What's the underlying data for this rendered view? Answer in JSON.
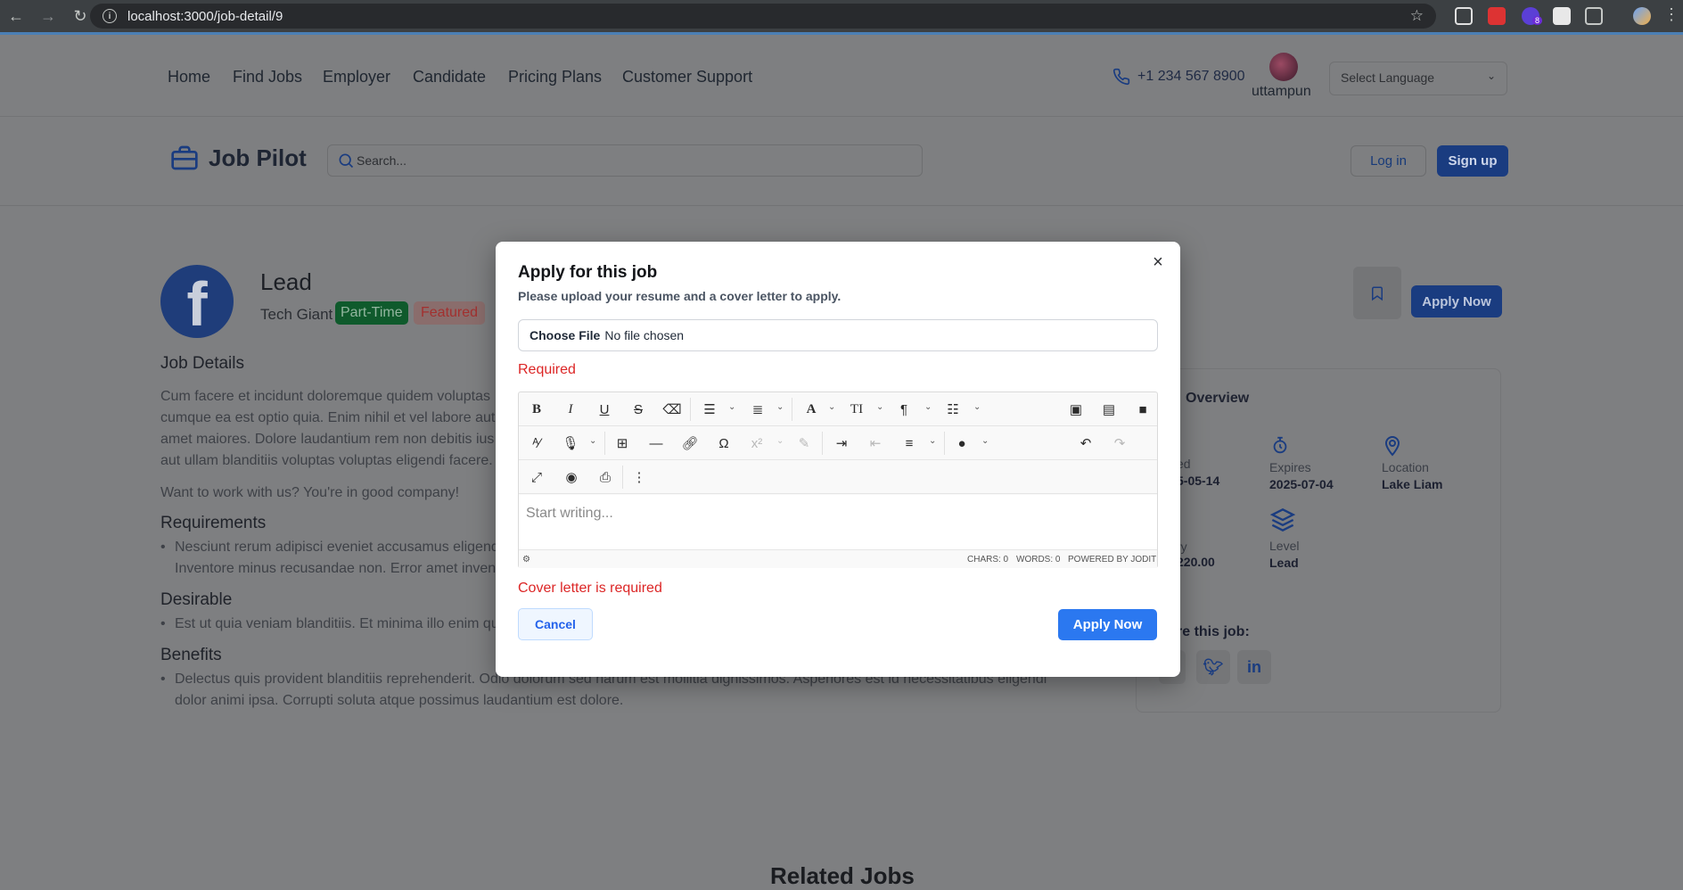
{
  "browser": {
    "url": "localhost:3000/job-detail/9",
    "ext_badge": "8"
  },
  "nav": {
    "links": [
      "Home",
      "Find Jobs",
      "Employer",
      "Candidate",
      "Pricing Plans",
      "Customer Support"
    ],
    "phone": "+1 234 567 8900",
    "username": "uttampun",
    "language_placeholder": "Select Language"
  },
  "header": {
    "logo_text": "Job Pilot",
    "search_placeholder": "Search...",
    "login": "Log in",
    "signup": "Sign up"
  },
  "job": {
    "logo_letter": "f",
    "title": "Lead",
    "company": "Tech Giant",
    "tags": [
      "Part-Time",
      "Featured"
    ],
    "apply_now": "Apply Now",
    "details_heading": "Job Details",
    "details_lines": [
      "Cum facere et incidunt doloremque quidem voluptas",
      "cumque ea est optio quia. Enim nihil et vel labore aut",
      "amet maiores. Dolore laudantium rem non debitis ius",
      "aut ullam blanditiis voluptas voluptas eligendi facere."
    ],
    "tagline": "Want to work with us? You're in good company!",
    "requirements_heading": "Requirements",
    "requirements_lines": [
      "Nesciunt rerum adipisci eveniet accusamus eligend",
      "Inventore minus recusandae non. Error amet invent"
    ],
    "desirable_heading": "Desirable",
    "desirable_line": "Est ut quia veniam blanditiis. Et minima illo enim qu",
    "benefits_heading": "Benefits",
    "benefits_lines": [
      "Delectus quis provident blanditiis reprehenderit. Odio dolorum sed harum est mollitia dignissimos. Asperiores est id necessitatibus eligendi",
      "dolor animi ipsa. Corrupti soluta atque possimus laudantium est dolore."
    ]
  },
  "overview": {
    "title": "Overview",
    "posted_label": "ed",
    "posted_value": "5-05-14",
    "expires_label": "Expires",
    "expires_value": "2025-07-04",
    "location_label": "Location",
    "location_value": "Lake Liam",
    "salary_label": "ry",
    "salary_value": "220.00",
    "level_label": "Level",
    "level_value": "Lead",
    "share_label": "re this job:"
  },
  "related_heading": "Related Jobs",
  "modal": {
    "title": "Apply for this job",
    "subtitle": "Please upload your resume and a cover letter to apply.",
    "choose_file": "Choose File",
    "no_file": "No file chosen",
    "required_error": "Required",
    "editor_placeholder": "Start writing...",
    "chars": "CHARS: 0",
    "words": "WORDS: 0",
    "powered": "POWERED BY JODIT",
    "cover_error": "Cover letter is required",
    "cancel": "Cancel",
    "apply": "Apply Now"
  },
  "colors": {
    "primary": "#2b78f0",
    "error": "#dc2626",
    "brand_dark": "#1a3c80"
  }
}
